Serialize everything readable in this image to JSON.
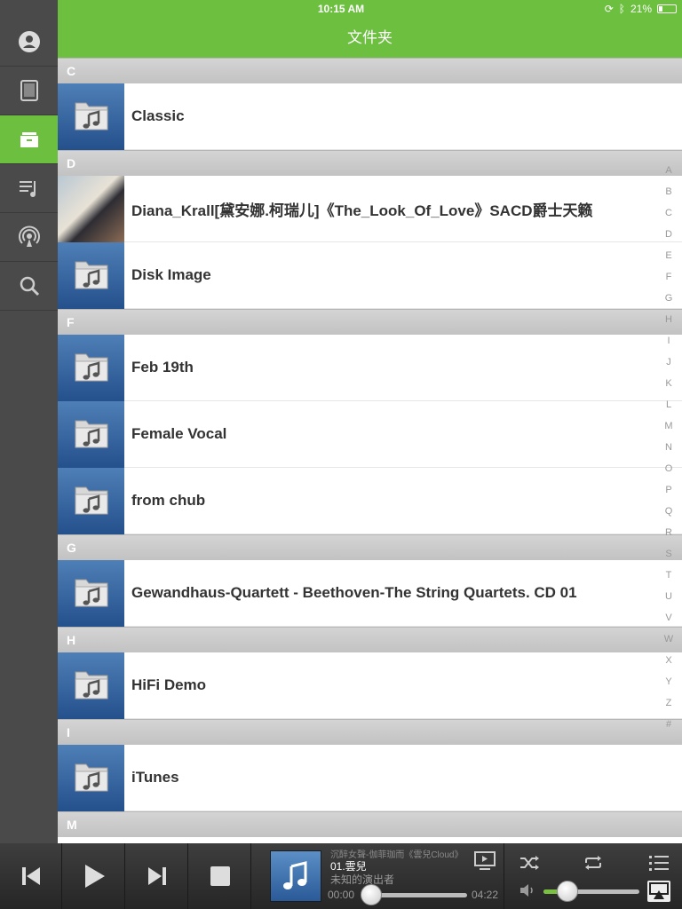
{
  "status": {
    "device": "iPad",
    "time": "10:15 AM",
    "battery": "21%"
  },
  "header": {
    "title": "文件夹"
  },
  "sidebar": {
    "items": [
      {
        "icon": "account-icon"
      },
      {
        "icon": "ipad-icon"
      },
      {
        "icon": "folder-icon",
        "active": true
      },
      {
        "icon": "playlist-icon"
      },
      {
        "icon": "broadcast-icon"
      },
      {
        "icon": "search-icon"
      }
    ]
  },
  "list": {
    "sections": [
      {
        "letter": "C",
        "rows": [
          "Classic"
        ]
      },
      {
        "letter": "D",
        "rows": [
          "Diana_Krall[黛安娜.柯瑞儿]《The_Look_Of_Love》SACD爵士天籁",
          "Disk Image"
        ]
      },
      {
        "letter": "F",
        "rows": [
          "Feb 19th",
          "Female Vocal",
          "from chub"
        ]
      },
      {
        "letter": "G",
        "rows": [
          "Gewandhaus-Quartett - Beethoven-The String Quartets. CD 01"
        ]
      },
      {
        "letter": "H",
        "rows": [
          "HiFi Demo"
        ]
      },
      {
        "letter": "I",
        "rows": [
          "iTunes"
        ]
      },
      {
        "letter": "M",
        "rows": []
      }
    ]
  },
  "index_letters": [
    "A",
    "B",
    "C",
    "D",
    "E",
    "F",
    "G",
    "H",
    "I",
    "J",
    "K",
    "L",
    "M",
    "N",
    "O",
    "P",
    "Q",
    "R",
    "S",
    "T",
    "U",
    "V",
    "W",
    "X",
    "Y",
    "Z",
    "#"
  ],
  "player": {
    "subtitle": "沉醉女聲-伽菲珈而《雲兒Cloud》",
    "track": "01.雲兒",
    "artist": "未知的演出者",
    "elapsed": "00:00",
    "duration": "04:22",
    "progress": 0.0,
    "volume": 0.25
  },
  "colors": {
    "accent": "#6cbf3f",
    "sidebar": "#4a4a4a",
    "folder_blue": "#2f5f9c"
  }
}
